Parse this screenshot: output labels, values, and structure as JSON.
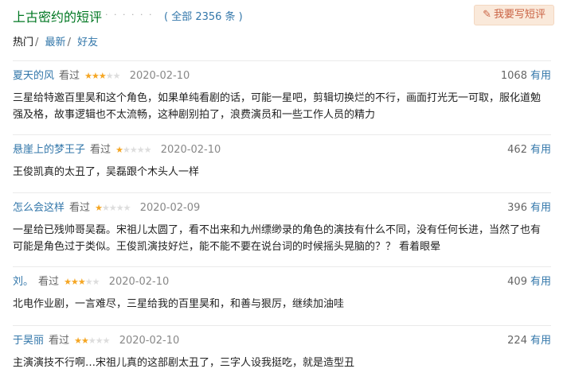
{
  "header": {
    "title": "上古密约的短评",
    "dots": "· · · · · ·",
    "count_link": "( 全部 2356 条 )",
    "write_label": "我要写短评"
  },
  "tabs": [
    {
      "label": "热门",
      "sep": "/"
    },
    {
      "label": "最新",
      "sep": "/"
    },
    {
      "label": "好友",
      "sep": ""
    }
  ],
  "comments": [
    {
      "user": "夏天的风",
      "seen": "看过",
      "rating": 3,
      "date": "2020-02-10",
      "votes": "1068",
      "useful": "有用",
      "lines": [
        "三星给特邀百里昊和这个角色，如果单纯看剧的话，可能一星吧，剪辑切换烂的不行，画面打光无一可取，服化道勉",
        "强及格，故事逻辑也不太流畅，这种剧别拍了，浪费演员和一些工作人员的精力"
      ]
    },
    {
      "user": "悬崖上的梦王子",
      "seen": "看过",
      "rating": 1,
      "date": "2020-02-10",
      "votes": "462",
      "useful": "有用",
      "lines": [
        "王俊凯真的太丑了，吴磊跟个木头人一样"
      ]
    },
    {
      "user": "怎么会这样",
      "seen": "看过",
      "rating": 1,
      "date": "2020-02-09",
      "votes": "396",
      "useful": "有用",
      "lines": [
        "一星给已残帅哥吴磊。宋祖儿太圆了，看不出来和九州缥缈录的角色的演技有什么不同，没有任何长进，当然了也有",
        "可能是角色过于类似。王俊凯演技好烂，能不能不要在说台词的时候摇头晃脑的？？ 看着眼晕"
      ]
    },
    {
      "user": "刘。",
      "seen": "看过",
      "rating": 3,
      "date": "2020-02-10",
      "votes": "409",
      "useful": "有用",
      "lines": [
        "北电作业剧，一言难尽，三星给我的百里昊和，和善与狠厉，继续加油哇"
      ]
    },
    {
      "user": "于昊丽",
      "seen": "看过",
      "rating": 2,
      "date": "2020-02-10",
      "votes": "224",
      "useful": "有用",
      "lines": [
        "主演演技不行啊…宋祖儿真的这部剧太丑了，三字人设我挺吃，就是造型丑"
      ]
    }
  ],
  "colors": {
    "title_green": "#007722",
    "link_blue": "#3377aa",
    "star": "#f5a623",
    "button_bg": "#fae9da",
    "button_text": "#ca6445"
  }
}
